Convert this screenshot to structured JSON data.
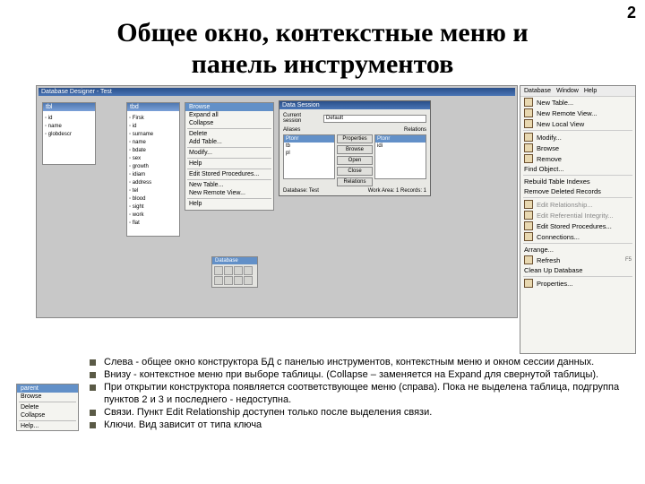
{
  "page_number": "2",
  "title_line1": "Общее окно, контекстные меню и",
  "title_line2": "панель инструментов",
  "designer": {
    "titlebar": "Database Designer - Test",
    "table1": {
      "title": "tbl",
      "fields": [
        "id",
        "name",
        "globdescr"
      ]
    },
    "table2": {
      "title": "tbd",
      "fields": [
        "Firsk",
        "id",
        "surname",
        "name",
        "bdate",
        "sex",
        "growth",
        "idiam",
        "address",
        "tel",
        "blood",
        "sight",
        "work",
        "flat"
      ]
    }
  },
  "ctx1": {
    "title": "Browse",
    "items": [
      "Expand all",
      "Collapse",
      "",
      "Delete",
      "Add Table...",
      "",
      "Modify...",
      "",
      "Help",
      "",
      "Edit Stored Procedures...",
      "",
      "New Table...",
      "New Remote View...",
      "",
      "Help"
    ]
  },
  "edit_session": {
    "title": "Data Session",
    "tab": "Default",
    "labels": {
      "current": "Current session",
      "aliases": "Aliases",
      "open": "Open",
      "relations": "Relations"
    },
    "buttons": [
      "Properties",
      "Browse",
      "Open",
      "Close",
      "Relations"
    ],
    "list1_header": "Ptonr",
    "list1_items": [
      "tb",
      "pl"
    ],
    "list2_header": "Ptonr",
    "list2_items": [
      "idi"
    ],
    "footer_left": "Database: Test",
    "footer_right": "Work Area: 1    Records: 1"
  },
  "mini_toolbar": {
    "title": "Database"
  },
  "right_menu": {
    "top": [
      "Database",
      "Window",
      "Help"
    ],
    "items": [
      "New Table...",
      "New Remote View...",
      "New Local View",
      "",
      "Modify...",
      "Browse",
      "Remove",
      "Find Object...",
      "",
      "Rebuild Table Indexes",
      "Remove Deleted Records",
      "",
      "Edit Relationship...",
      "Edit Referential Integrity...",
      "Edit Stored Procedures...",
      "Connections...",
      "",
      "Arrange...",
      "Refresh",
      "Clean Up Database",
      "",
      "Properties..."
    ],
    "refresh_key": "F5"
  },
  "small_ctx": {
    "title": "parent",
    "items": [
      "Browse",
      "",
      "Delete",
      "Collapse",
      "",
      "Help..."
    ]
  },
  "bullets": [
    "Слева - общее окно конструктора БД с панелью инструментов, контекстным меню и окном сессии данных.",
    "Внизу - контекстное меню при выборе таблицы. (Collapse – заменяется на Expand для свернутой таблицы).",
    "При открытии конструктора появляется соответствующее меню (справа). Пока не выделена таблица, подгруппа пунктов 2 и 3 и последнего - недоступна.",
    "Связи. Пункт Edit Relationship доступен только после выделения связи.",
    "Ключи. Вид зависит от типа ключа"
  ]
}
